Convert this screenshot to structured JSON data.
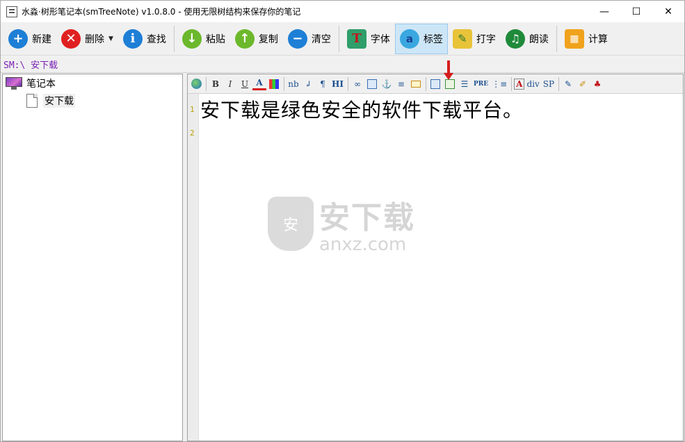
{
  "window": {
    "title": "水淼·树形笔记本(smTreeNote) v1.0.8.0 - 使用无限树结构来保存你的笔记",
    "minimize": "—",
    "maximize": "☐",
    "close": "✕"
  },
  "toolbar": {
    "new_label": "新建",
    "delete_label": "删除",
    "find_label": "查找",
    "paste_label": "粘贴",
    "copy_label": "复制",
    "clear_label": "清空",
    "font_label": "字体",
    "tag_label": "标签",
    "type_label": "打字",
    "read_label": "朗读",
    "calc_label": "计算"
  },
  "path": "SM:\\ 安下载",
  "tree": {
    "root_label": "笔记本",
    "child_label": "安下载"
  },
  "format_bar": {
    "bold": "B",
    "italic": "I",
    "underline": "U",
    "font_color": "A",
    "nbsp": "nb",
    "linebreak": "↲",
    "paragraph": "¶",
    "heading": "HI",
    "pre": "PRE",
    "div": "div",
    "sp": "SP",
    "font": "A"
  },
  "editor": {
    "line1_number": "1",
    "line2_number": "2",
    "line1_text": "安下载是绿色安全的软件下载平台。"
  },
  "watermark": {
    "shield_char": "安",
    "cn": "安下载",
    "en": "anxz.com"
  },
  "colors": {
    "path_text": "#7a1fb5",
    "tag_button_bg": "#cde6f7",
    "annotation_arrow": "#d61d1d",
    "line_numbers": "#b9a100"
  }
}
